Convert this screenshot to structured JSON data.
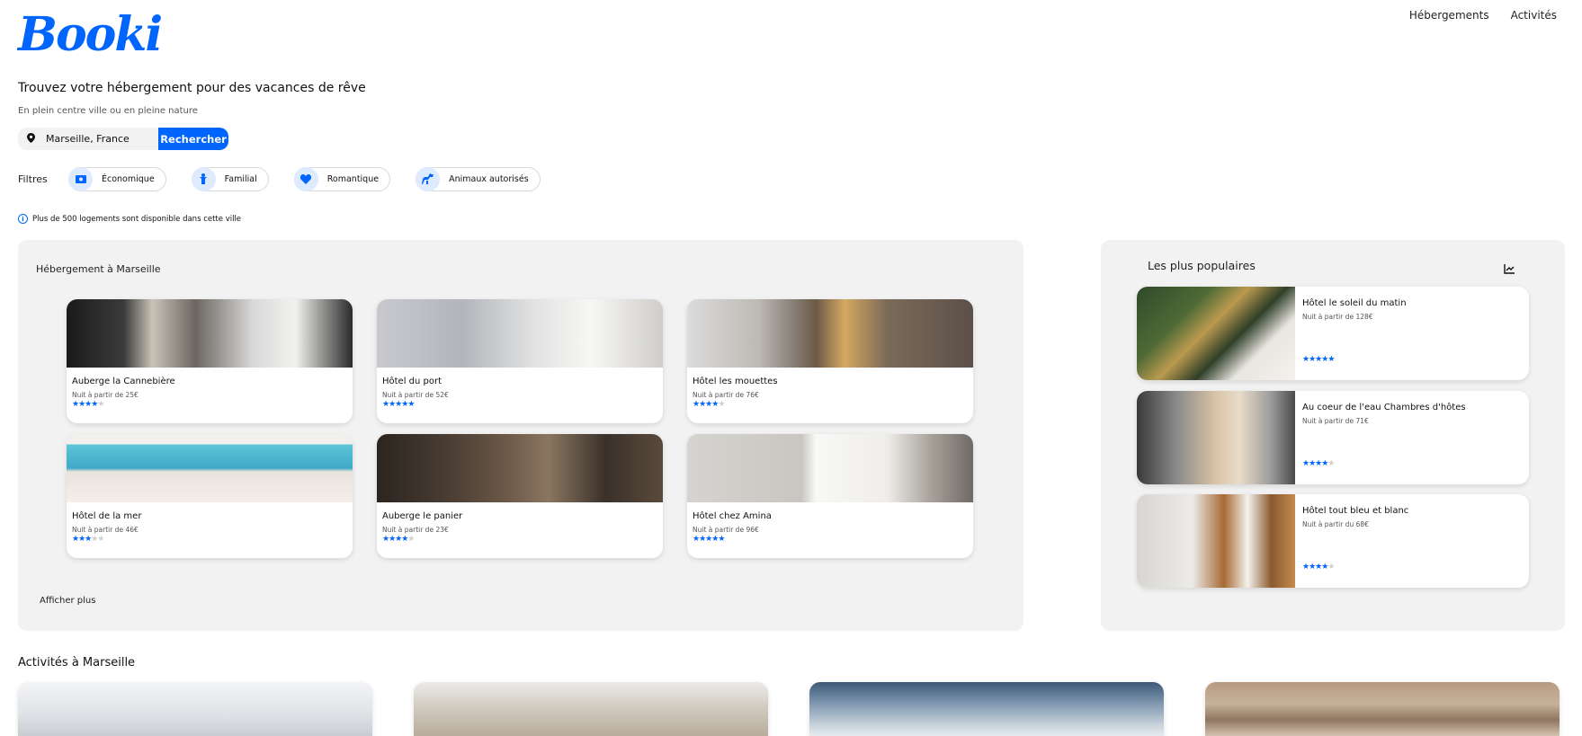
{
  "header": {
    "logo": "Booki",
    "nav": [
      "Hébergements",
      "Activités"
    ]
  },
  "hero": {
    "title": "Trouvez votre hébergement pour des vacances de rêve",
    "subtitle": "En plein centre ville ou en pleine nature"
  },
  "search": {
    "value": "Marseille, France",
    "button": "Rechercher",
    "icon": "location-pin-icon"
  },
  "filters": {
    "label": "Filtres",
    "items": [
      {
        "label": "Économique",
        "icon": "money-icon"
      },
      {
        "label": "Familial",
        "icon": "child-icon"
      },
      {
        "label": "Romantique",
        "icon": "heart-icon"
      },
      {
        "label": "Animaux autorisés",
        "icon": "dog-icon"
      }
    ]
  },
  "info": {
    "text": "Plus de 500 logements sont disponible dans cette ville"
  },
  "accommodations": {
    "title": "Hébergement à Marseille",
    "more": "Afficher plus",
    "items": [
      {
        "name": "Auberge la Cannebière",
        "price": "Nuit à partir de 25€",
        "rating": 4
      },
      {
        "name": "Hôtel du port",
        "price": "Nuit à partir de 52€",
        "rating": 5
      },
      {
        "name": "Hôtel les mouettes",
        "price": "Nuit à partir de 76€",
        "rating": 4
      },
      {
        "name": "Hôtel de la mer",
        "price": "Nuit à partir de 46€",
        "rating": 3
      },
      {
        "name": "Auberge le panier",
        "price": "Nuit à partir de 23€",
        "rating": 4
      },
      {
        "name": "Hôtel chez Amina",
        "price": "Nuit à partir de 96€",
        "rating": 5
      }
    ]
  },
  "popular": {
    "title": "Les plus populaires",
    "icon": "trending-chart-icon",
    "items": [
      {
        "name": "Hôtel le soleil du matin",
        "price": "Nuit à partir de 128€",
        "rating": 5
      },
      {
        "name": "Au coeur de l'eau Chambres d'hôtes",
        "price": "Nuit à partir de 71€",
        "rating": 4
      },
      {
        "name": "Hôtel tout bleu et blanc",
        "price": "Nuit à partir du 68€",
        "rating": 4
      }
    ]
  },
  "activities": {
    "title": "Activités à Marseille"
  },
  "colors": {
    "accent": "#0065fc",
    "panel": "#f2f2f2"
  }
}
